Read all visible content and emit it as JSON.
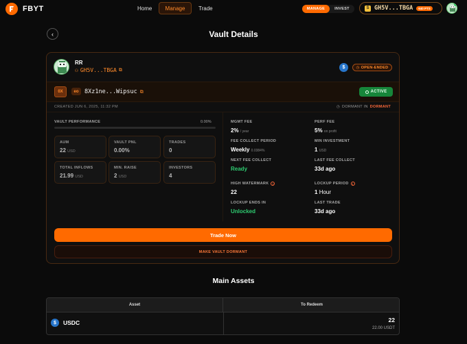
{
  "nav": {
    "brand": "FBYT",
    "links": [
      "Home",
      "Manage",
      "Trade"
    ],
    "toggle": {
      "on": "MANAGE",
      "off": "INVEST"
    },
    "wallet": {
      "icon": "wallet-icon",
      "address": "GH5V...TBGA",
      "points": "640 PTS"
    }
  },
  "header": {
    "title": "Vault Details"
  },
  "vault": {
    "owner_name": "RR",
    "owner_address": "GH5V...TBGA",
    "type_badge": "OPEN-ENDED",
    "address_prefix": "0X",
    "address_tag": "eo",
    "address": "8Xz1ne...Wipsuc",
    "status": "ACTIVE",
    "created": "CREATED JUN 6, 2025, 11:32 PM",
    "dormant_label": "DORMANT IN",
    "dormant_value": "DORMANT",
    "performance_label": "VAULT PERFORMANCE",
    "performance_value": "0.00%",
    "performance_fraction": 0.0,
    "stats": [
      {
        "label": "AUM",
        "value": "22",
        "unit": "USD"
      },
      {
        "label": "VAULT PNL",
        "value": "0.00%",
        "unit": ""
      },
      {
        "label": "TRADES",
        "value": "0",
        "unit": ""
      },
      {
        "label": "TOTAL INFLOWS",
        "value": "21.99",
        "unit": "USD"
      },
      {
        "label": "MIN. RAISE",
        "value": "2",
        "unit": "USD"
      },
      {
        "label": "INVESTORS",
        "value": "4",
        "unit": ""
      }
    ],
    "info": {
      "mgmt_fee": {
        "label": "MGMT FEE",
        "value": "2%",
        "unit": "/ year"
      },
      "perf_fee": {
        "label": "PERF FEE",
        "value": "5%",
        "unit": "on profit"
      },
      "fee_period": {
        "label": "FEE COLLECT PERIOD",
        "value": "Weekly",
        "unit": "0.0384%"
      },
      "min_investment": {
        "label": "MIN INVESTMENT",
        "value": "1",
        "unit": "USD"
      },
      "next_fee": {
        "label": "NEXT FEE COLLECT",
        "value": "Ready"
      },
      "last_fee": {
        "label": "LAST FEE COLLECT",
        "value": "33d ago"
      },
      "high_watermark": {
        "label": "HIGH WATERMARK",
        "value": "22"
      },
      "lockup_period": {
        "label": "LOCKUP PERIOD",
        "value": "1",
        "unit": "Hour"
      },
      "lockup_ends": {
        "label": "LOCKUP ENDS IN",
        "value": "Unlocked"
      },
      "last_trade": {
        "label": "LAST TRADE",
        "value": "33d ago"
      }
    },
    "trade_button": "Trade Now",
    "dormant_button": "MAKE VAULT DORMANT"
  },
  "assets": {
    "title": "Main Assets",
    "columns": [
      "Asset",
      "To Redeem"
    ],
    "rows": [
      {
        "icon": "usdc-icon",
        "name": "USDC",
        "redeem": "22",
        "redeem_sub": "22.00 USDT"
      }
    ]
  },
  "colors": {
    "accent": "#ff6a00",
    "active": "#16863a",
    "ready": "#2ecc71",
    "usdc": "#2775ca"
  }
}
